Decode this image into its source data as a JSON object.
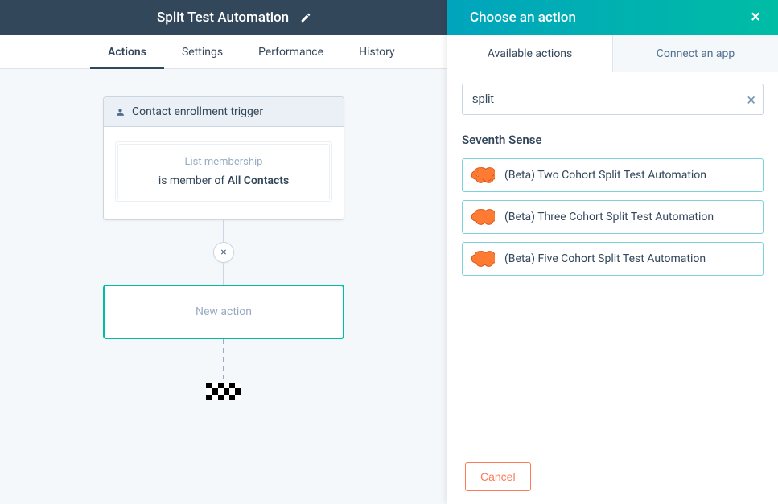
{
  "header": {
    "title": "Split Test Automation"
  },
  "tabs": {
    "items": [
      {
        "label": "Actions",
        "active": true
      },
      {
        "label": "Settings",
        "active": false
      },
      {
        "label": "Performance",
        "active": false
      },
      {
        "label": "History",
        "active": false
      }
    ]
  },
  "trigger": {
    "header": "Contact enrollment trigger",
    "type_label": "List membership",
    "desc_prefix": "is member of ",
    "desc_bold": "All Contacts"
  },
  "new_action_label": "New action",
  "panel": {
    "title": "Choose an action",
    "tab_available": "Available actions",
    "tab_connect": "Connect an app",
    "search_value": "split",
    "section_title": "Seventh Sense",
    "actions": [
      {
        "label": "(Beta) Two Cohort Split Test Automation"
      },
      {
        "label": "(Beta) Three Cohort Split Test Automation"
      },
      {
        "label": "(Beta) Five Cohort Split Test Automation"
      }
    ],
    "cancel_label": "Cancel"
  }
}
